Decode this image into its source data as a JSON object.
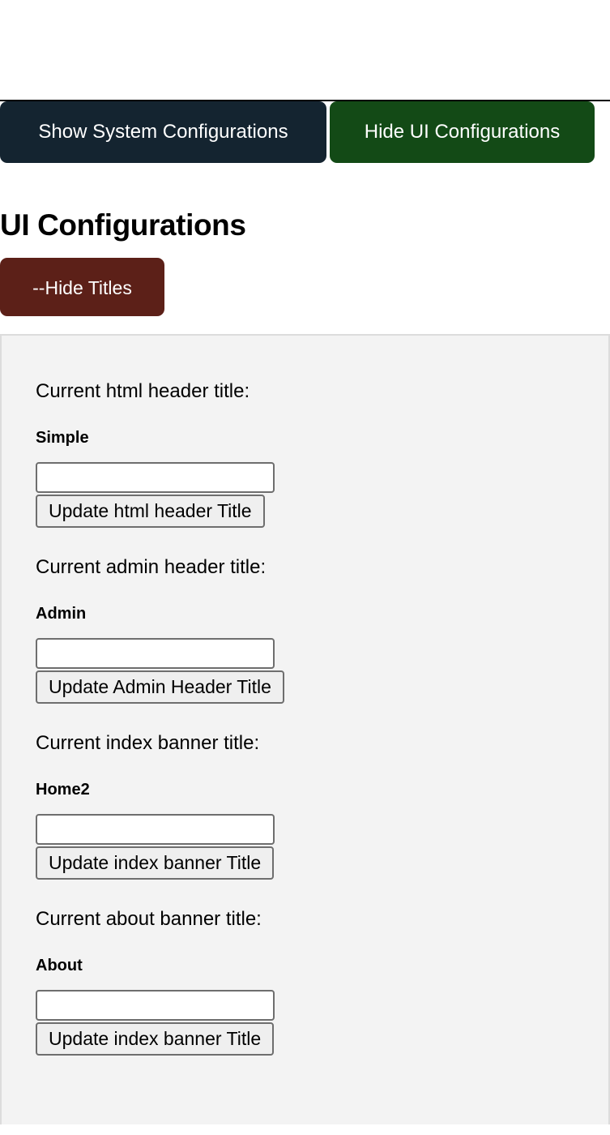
{
  "nav": {
    "show_system_configurations": "Show System Configurations",
    "hide_ui_configurations": "Hide UI Configurations"
  },
  "page": {
    "heading": "UI Configurations",
    "hide_titles_toggle": "--Hide Titles"
  },
  "colors": {
    "dark_button": "#142430",
    "green_button": "#134a16",
    "maroon_button": "#5c2018",
    "panel_background": "#f3f3f3",
    "panel_border": "#dcdcdc"
  },
  "fields": [
    {
      "legend": "Current html header title:",
      "current_value": "Simple",
      "input_value": "",
      "input_placeholder": "",
      "submit_label": "Update html header Title"
    },
    {
      "legend": "Current admin header title:",
      "current_value": "Admin",
      "input_value": "",
      "input_placeholder": "",
      "submit_label": "Update Admin Header Title"
    },
    {
      "legend": "Current index banner title:",
      "current_value": "Home2",
      "input_value": "",
      "input_placeholder": "",
      "submit_label": "Update index banner Title"
    },
    {
      "legend": "Current about banner title:",
      "current_value": "About",
      "input_value": "",
      "input_placeholder": "",
      "submit_label": "Update index banner Title"
    }
  ]
}
